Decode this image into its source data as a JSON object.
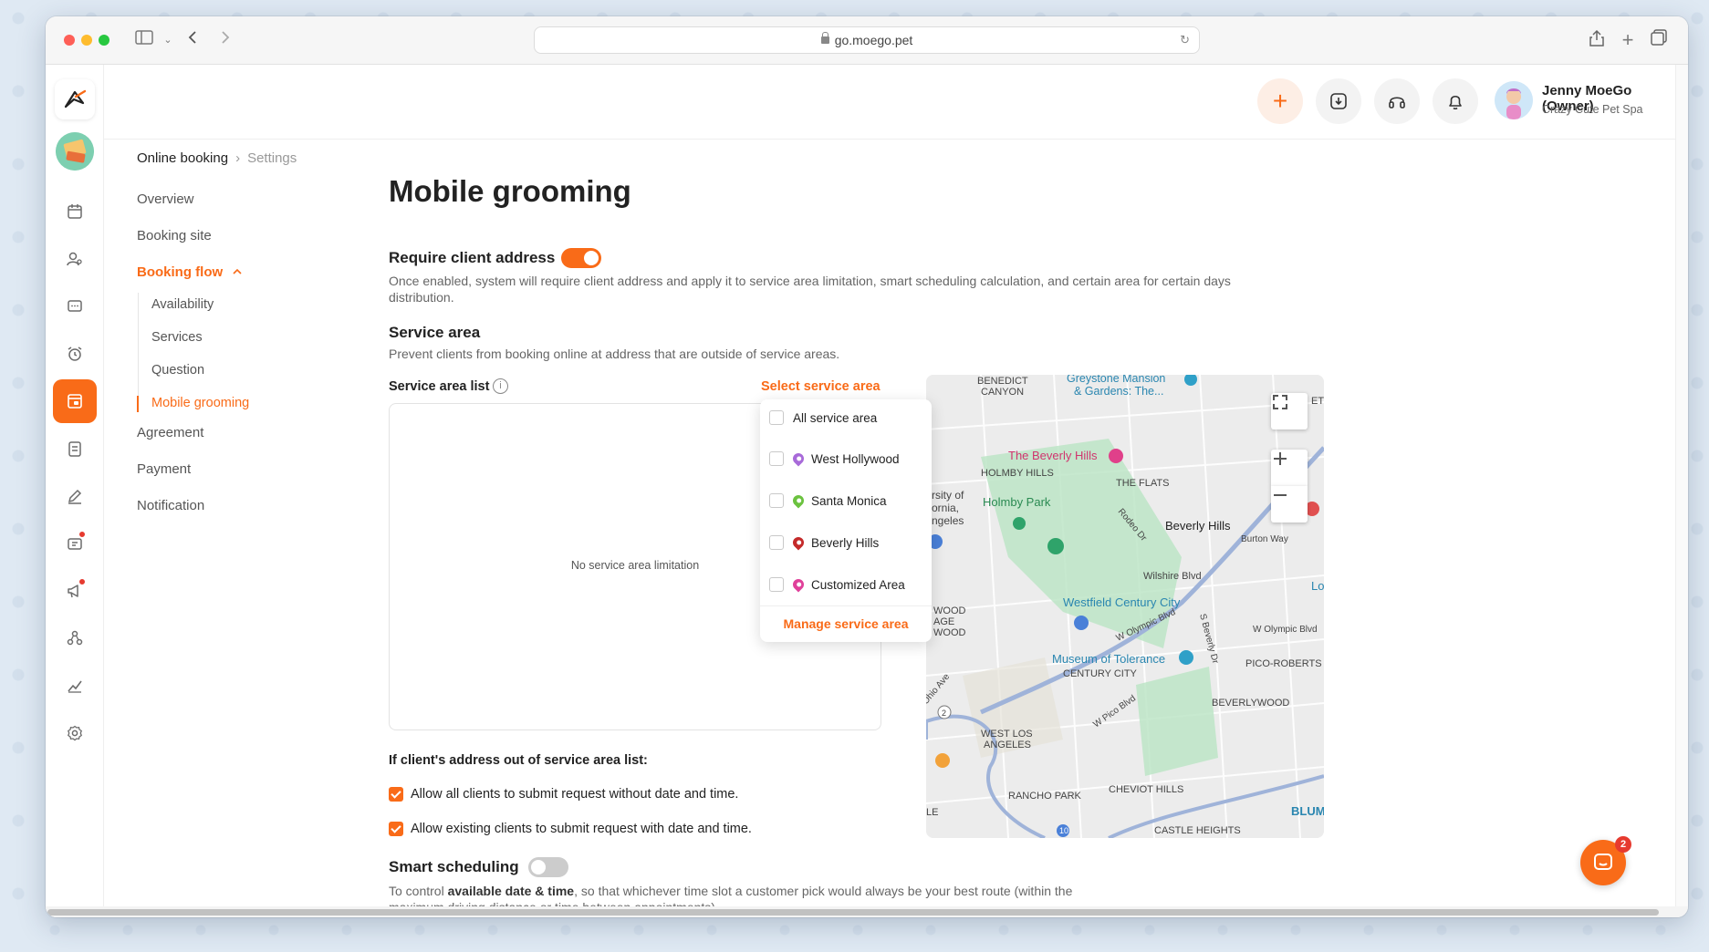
{
  "browser": {
    "url": "go.moego.pet"
  },
  "header": {
    "user_name": "Jenny MoeGo (Owner)",
    "business_name": "Crazy Cute Pet Spa"
  },
  "breadcrumb": {
    "parent": "Online booking",
    "current": "Settings"
  },
  "subnav": {
    "overview": "Overview",
    "booking_site": "Booking site",
    "booking_flow": "Booking flow",
    "availability": "Availability",
    "services": "Services",
    "question": "Question",
    "mobile_grooming": "Mobile grooming",
    "agreement": "Agreement",
    "payment": "Payment",
    "notification": "Notification"
  },
  "main": {
    "title": "Mobile grooming",
    "require_address": {
      "label": "Require client address",
      "enabled": true,
      "description": "Once enabled, system will require client address and apply it to service area limitation, smart scheduling calculation, and certain area for certain days distribution."
    },
    "service_area": {
      "label": "Service area",
      "description": "Prevent clients from booking online at address that are outside of service areas.",
      "list_label": "Service area list",
      "select_link": "Select service area",
      "empty_text": "No service area limitation"
    },
    "dropdown": {
      "all": "All service area",
      "items": [
        {
          "label": "West Hollywood",
          "color": "#a86ad9"
        },
        {
          "label": "Santa Monica",
          "color": "#6bc23f"
        },
        {
          "label": "Beverly Hills",
          "color": "#c42a2a"
        },
        {
          "label": "Customized Area",
          "color": "#e0409a"
        }
      ],
      "manage": "Manage service area"
    },
    "out_of_area": {
      "label": "If client's address out of service area list:",
      "option1": "Allow all clients to submit request without date and time.",
      "option2": "Allow existing clients to submit request with date and time."
    },
    "smart_scheduling": {
      "label": "Smart scheduling",
      "enabled": false,
      "desc_prefix": "To control ",
      "desc_bold": "available date & time",
      "desc_suffix": ", so that whichever time slot a customer pick would always be your best route (within the maximum driving distance or time between appointments)."
    }
  },
  "map": {
    "labels": {
      "benedict": "BENEDICT\nCANYON",
      "greystone": "Greystone Mansion",
      "greystone2": "& Gardens: The...",
      "beverly_hotel": "The Beverly Hills",
      "holmby_hills": "HOLMBY HILLS",
      "the_flats": "THE FLATS",
      "holmby_park": "Holmby Park",
      "beverly_hills": "Beverly Hills",
      "rodeo": "Rodeo Dr",
      "burton": "Burton Way",
      "wilshire": "Wilshire Blvd",
      "westfield": "Westfield Century City",
      "w_olympic": "W Olympic Blvd",
      "w_olympic2": "W Olympic Blvd",
      "s_beverly": "S Beverly Dr",
      "museum": "Museum of Tolerance",
      "century_city": "CENTURY CITY",
      "pico_robertson": "PICO-ROBERTS",
      "beverlywood": "BEVERLYWOOD",
      "w_pico": "W Pico Blvd",
      "west_la": "WEST LOS\nANGELES",
      "rancho_park": "RANCHO PARK",
      "cheviot": "CHEVIOT HILLS",
      "castle": "CASTLE HEIGHTS",
      "blu": "BLUM",
      "sity": "rsity of\nornia,\nngeles",
      "wood": "WOOD\nAGE\nWOOD",
      "ohio": "Ohio Ave",
      "et": "ET",
      "lo": "Lo",
      "le": "LE",
      "route2": "2",
      "route10": "10"
    }
  },
  "chat": {
    "badge_count": "2"
  },
  "colors": {
    "accent": "#f96b18"
  }
}
